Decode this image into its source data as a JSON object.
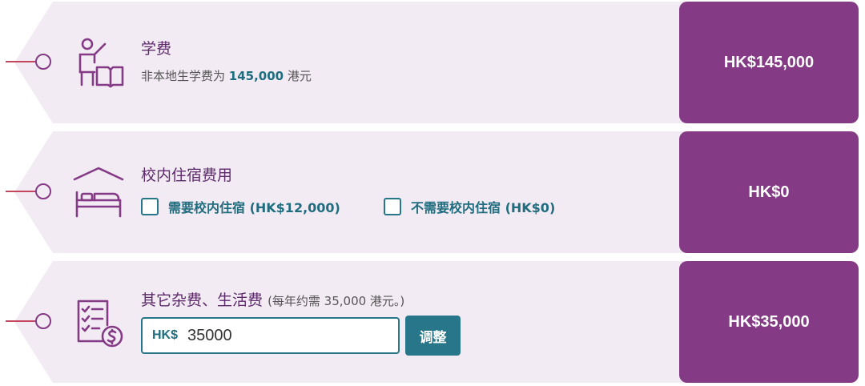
{
  "colors": {
    "purple": "#843a84",
    "tag_background": "#f3ebf4",
    "teal": "#27768a",
    "string_red": "#c4465e"
  },
  "tuition": {
    "title": "学费",
    "subtitle_prefix": "非本地生学费为",
    "subtitle_amount": "145,000",
    "subtitle_suffix": "港元",
    "price": "HK$145,000",
    "icon": "teacher-book-icon"
  },
  "housing": {
    "title": "校内住宿费用",
    "option_need": "需要校内住宿 (HK$12,000)",
    "option_no_need": "不需要校内住宿 (HK$0)",
    "option_need_checked": false,
    "option_no_need_checked": false,
    "price": "HK$0",
    "icon": "bed-house-icon"
  },
  "misc": {
    "title": "其它杂费、生活费",
    "note": "(每年约需 35,000 港元。)",
    "currency_prefix": "HK$",
    "amount_value": "35000",
    "adjust_label": "调整",
    "price": "HK$35,000",
    "icon": "checklist-dollar-icon"
  }
}
